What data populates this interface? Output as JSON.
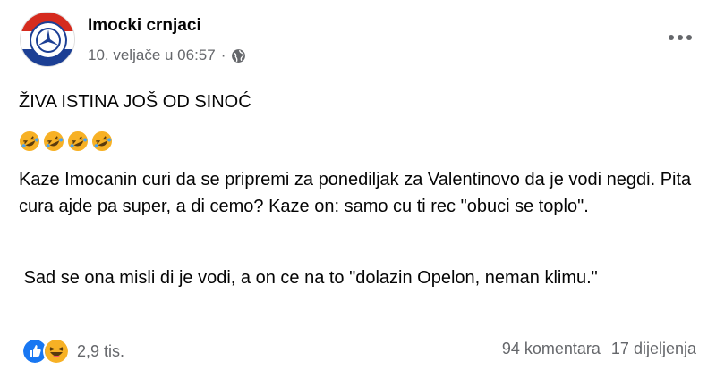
{
  "post": {
    "author": "Imocki crnjaci",
    "date": "10. veljače u 06:57",
    "separator": "·",
    "privacy_icon": "globe-icon",
    "headline": "ŽIVA ISTINA JOŠ OD SINOĆ",
    "emoji_icons": [
      "rofl-emoji",
      "rofl-emoji",
      "rofl-emoji",
      "rofl-emoji"
    ],
    "paragraph1": "Kaze Imocanin curi da se pripremi za ponediljak za Valentinovo da je vodi negdi. Pita cura ajde pa super, a di cemo? Kaze on: samo cu ti rec \"obuci se toplo\".",
    "paragraph2": " Sad se ona misli di je vodi, a on ce na to \"dolazin Opelon, neman klimu.\""
  },
  "footer": {
    "reaction_icons": [
      "like-icon",
      "haha-icon"
    ],
    "reaction_count": "2,9 tis.",
    "comments": "94 komentara",
    "shares": "17 dijeljenja"
  },
  "colors": {
    "secondary_text": "#65676b",
    "like_blue": "#1877f2",
    "haha_yellow": "#f7b125"
  }
}
